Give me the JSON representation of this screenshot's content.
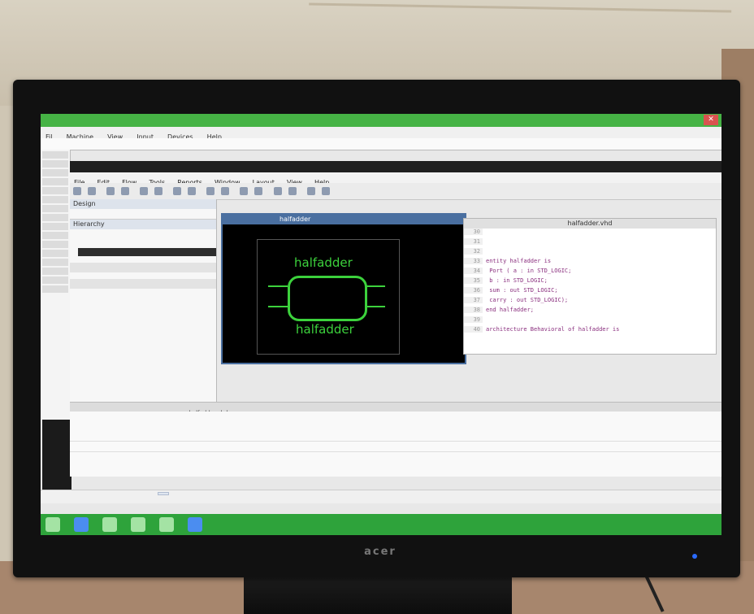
{
  "outer_window": {
    "title": "",
    "menu": [
      "Fil",
      "Machine",
      "View",
      "Input",
      "Devices",
      "Help"
    ],
    "address": "",
    "close_symbol": "✕"
  },
  "vivado": {
    "title": "",
    "menu": [
      "File",
      "Edit",
      "Flow",
      "Tools",
      "Reports",
      "Window",
      "Layout",
      "View",
      "Help"
    ],
    "left_panel": {
      "header": "Design",
      "tabs": "",
      "hierarchy_label": "Hierarchy",
      "tree": [
        "",
        "",
        ""
      ],
      "section1": "",
      "section2": ""
    },
    "schematic": {
      "title": "halfadder",
      "cell_name_top": "halfadder",
      "cell_name_bottom": "halfadder"
    },
    "code": {
      "title": "halfadder.vhd",
      "lines": [
        {
          "n": "30",
          "text": ""
        },
        {
          "n": "31",
          "text": ""
        },
        {
          "n": "32",
          "text": ""
        },
        {
          "n": "33",
          "text": "entity halfadder is"
        },
        {
          "n": "34",
          "text": "  Port ( a : in  STD_LOGIC;"
        },
        {
          "n": "35",
          "text": "         b : in  STD_LOGIC;"
        },
        {
          "n": "36",
          "text": "         sum : out  STD_LOGIC;"
        },
        {
          "n": "37",
          "text": "         carry : out  STD_LOGIC);"
        },
        {
          "n": "38",
          "text": "end halfadder;"
        },
        {
          "n": "39",
          "text": ""
        },
        {
          "n": "40",
          "text": "architecture Behavioral of halfadder is"
        }
      ]
    },
    "tabs": [
      "",
      "",
      "",
      "",
      "halfadder.vhd"
    ],
    "bottom": {
      "col1": "",
      "col2": "",
      "warning": ""
    }
  },
  "windows_taskbar": {
    "task_label": "",
    "clock": ""
  },
  "monitor": {
    "brand": "acer"
  }
}
